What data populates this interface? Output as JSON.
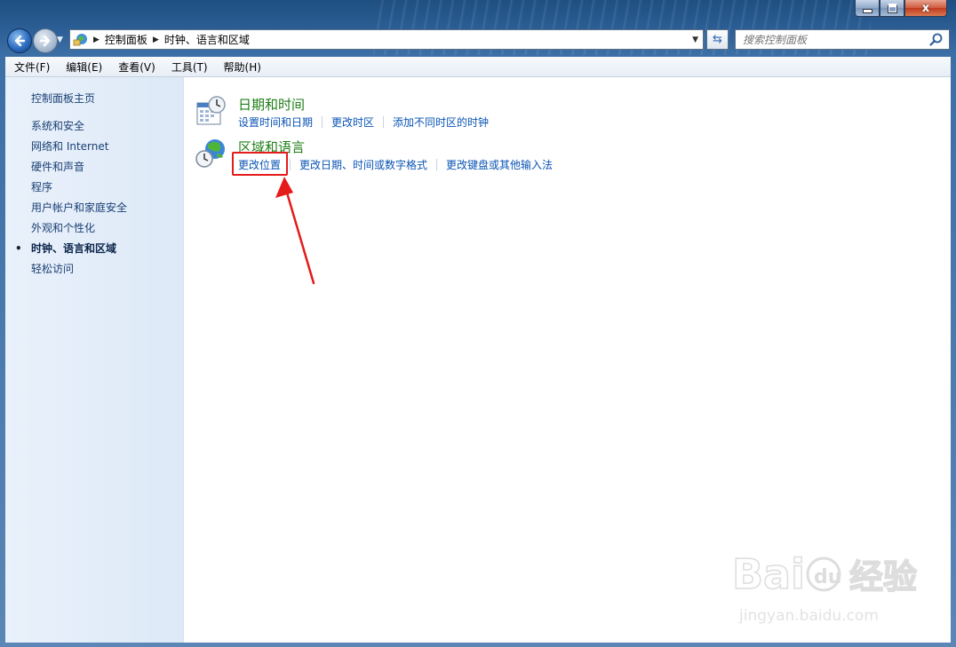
{
  "window": {
    "address_crumbs": [
      "控制面板",
      "时钟、语言和区域"
    ],
    "search_placeholder": "搜索控制面板",
    "caption_buttons": {
      "minimize": "–",
      "maximize": "□",
      "close": "x"
    }
  },
  "menu": [
    "文件(F)",
    "编辑(E)",
    "查看(V)",
    "工具(T)",
    "帮助(H)"
  ],
  "sidebar": {
    "home": "控制面板主页",
    "items": [
      {
        "label": "系统和安全",
        "active": false
      },
      {
        "label": "网络和 Internet",
        "active": false
      },
      {
        "label": "硬件和声音",
        "active": false
      },
      {
        "label": "程序",
        "active": false
      },
      {
        "label": "用户帐户和家庭安全",
        "active": false
      },
      {
        "label": "外观和个性化",
        "active": false
      },
      {
        "label": "时钟、语言和区域",
        "active": true
      },
      {
        "label": "轻松访问",
        "active": false
      }
    ]
  },
  "categories": [
    {
      "title": "日期和时间",
      "icon": "calendar-clock-icon",
      "links": [
        "设置时间和日期",
        "更改时区",
        "添加不同时区的时钟"
      ]
    },
    {
      "title": "区域和语言",
      "icon": "globe-clock-icon",
      "links": [
        "更改位置",
        "更改日期、时间或数字格式",
        "更改键盘或其他输入法"
      ]
    }
  ],
  "annotation": {
    "highlighted_link": "更改位置",
    "arrow_color": "#e51a1a"
  },
  "watermark": {
    "brand": "Bai 经验",
    "url": "jingyan.baidu.com"
  },
  "colors": {
    "title_green": "#1e7e17",
    "link_blue": "#0a54b5",
    "sidebar_text": "#1a3f73"
  }
}
